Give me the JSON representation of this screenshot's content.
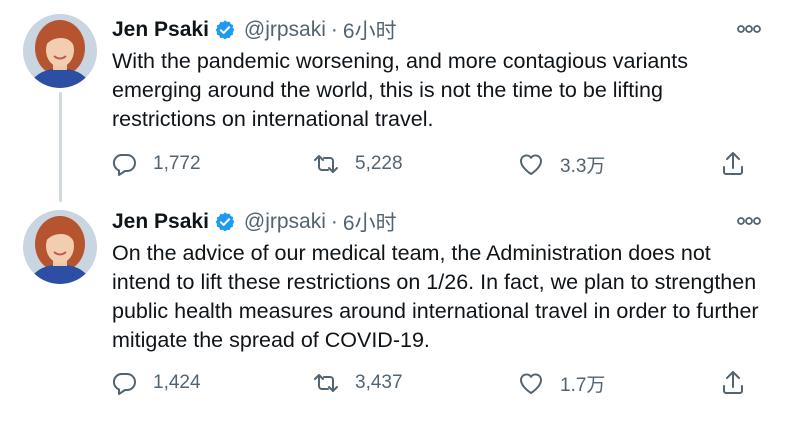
{
  "colors": {
    "text": "#0f1419",
    "secondary": "#536471",
    "verified": "#1d9bf0",
    "thread_line": "#cfd9de"
  },
  "tweets": [
    {
      "author_name": "Jen Psaki",
      "handle": "@jrpsaki",
      "separator": "·",
      "time": "6小时",
      "text": "With the pandemic worsening, and more contagious variants emerging around the world, this is not the time to be lifting restrictions on international travel.",
      "replies": "1,772",
      "retweets": "5,228",
      "likes": "3.3万",
      "icons": [
        "verified-icon",
        "more-icon",
        "reply-icon",
        "retweet-icon",
        "like-icon",
        "share-icon"
      ]
    },
    {
      "author_name": "Jen Psaki",
      "handle": "@jrpsaki",
      "separator": "·",
      "time": "6小时",
      "text": "On the advice of our medical team, the Administration does not intend to lift these restrictions on 1/26.  In fact, we plan to strengthen public health measures around international travel in order to further mitigate the spread of COVID-19.",
      "replies": "1,424",
      "retweets": "3,437",
      "likes": "1.7万",
      "icons": [
        "verified-icon",
        "more-icon",
        "reply-icon",
        "retweet-icon",
        "like-icon",
        "share-icon"
      ]
    }
  ]
}
